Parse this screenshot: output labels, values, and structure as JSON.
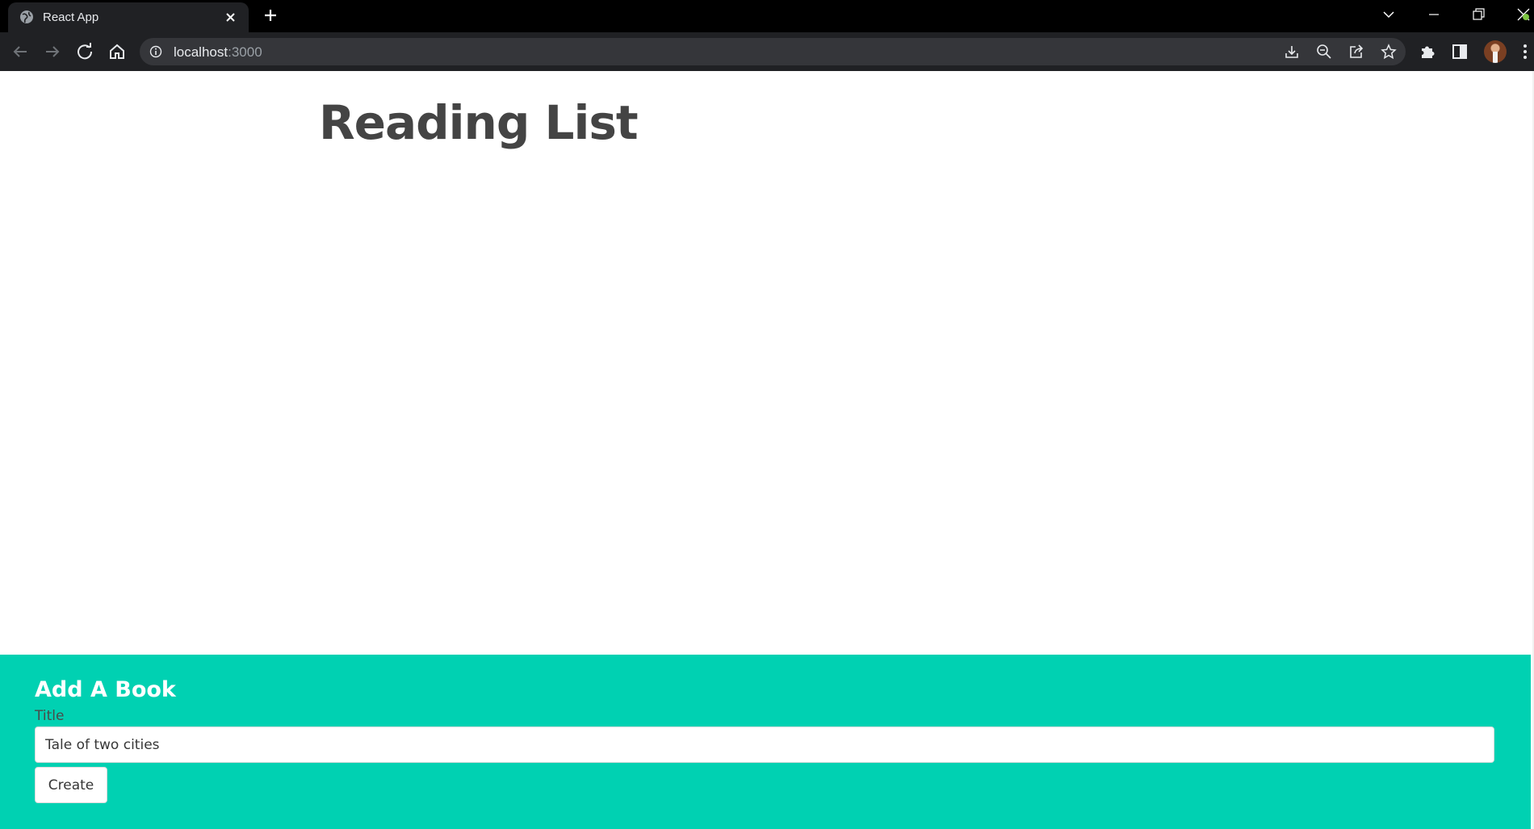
{
  "browser": {
    "tab": {
      "title": "React App"
    },
    "address_bar": {
      "host": "localhost",
      "port": ":3000"
    }
  },
  "page": {
    "title": "Reading List",
    "book_create": {
      "heading": "Add A Book",
      "title_label": "Title",
      "title_value": "Tale of two cities",
      "create_button_label": "Create",
      "background_color": "#00d1b2"
    }
  }
}
